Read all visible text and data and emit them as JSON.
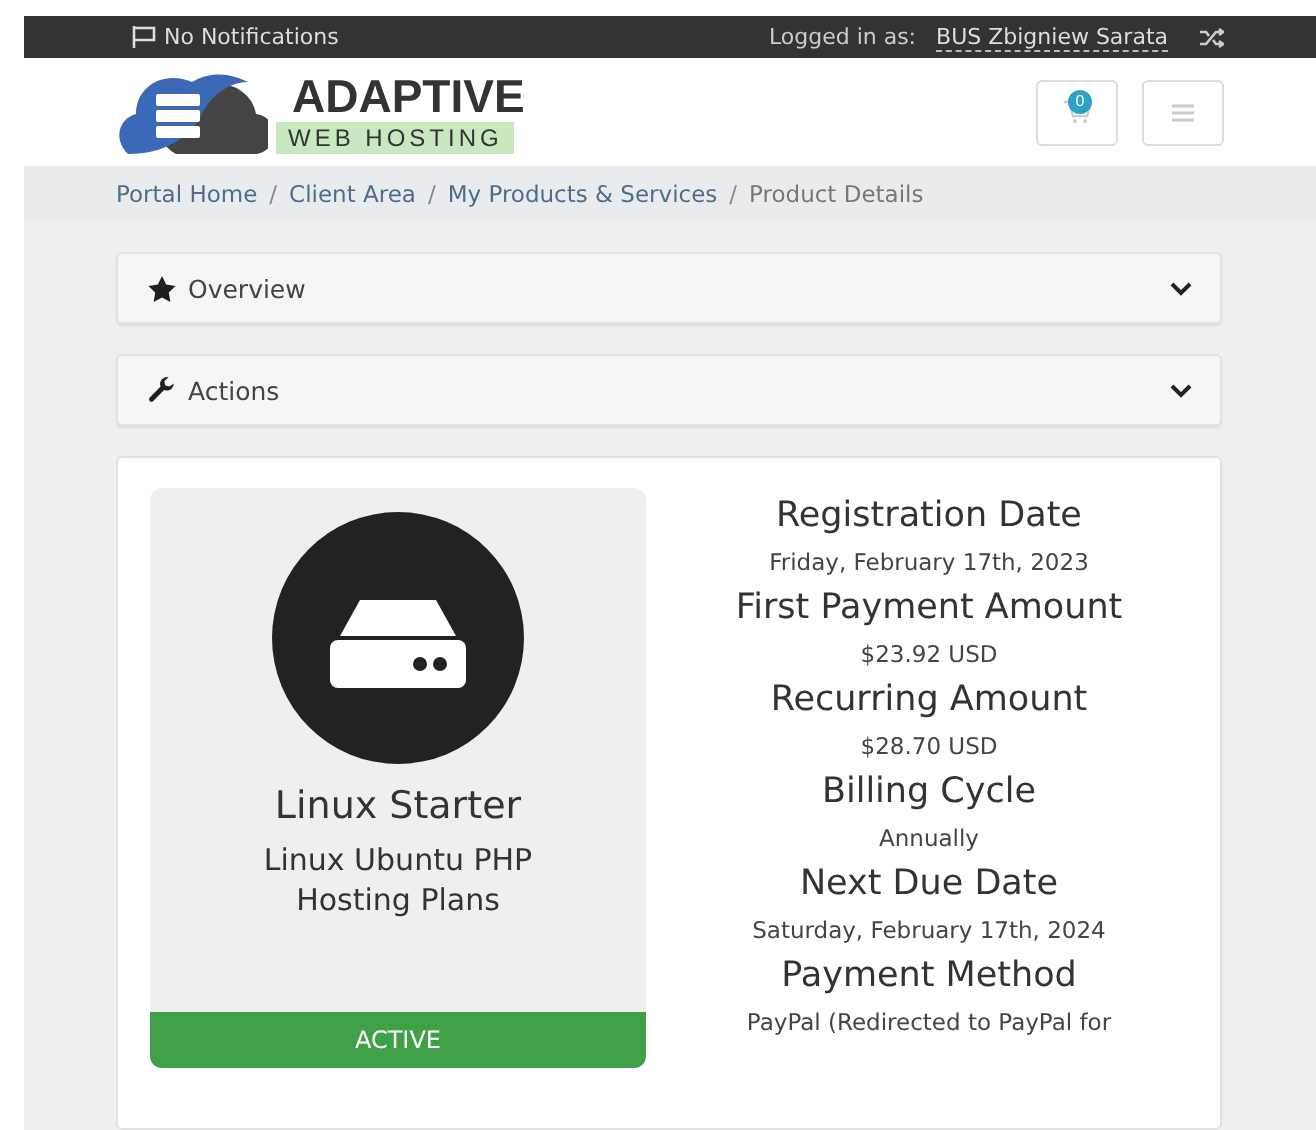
{
  "top_bar": {
    "notifications": "No Notifications",
    "logged_in_label": "Logged in as:",
    "user": "BUS Zbigniew Sarata"
  },
  "header": {
    "logo": {
      "title": "ADAPTIVE",
      "subtitle": "WEB HOSTING"
    },
    "cart_count": "0"
  },
  "breadcrumb": [
    {
      "label": "Portal Home",
      "link": true
    },
    {
      "separator": "/",
      "label": "Client Area",
      "link": true
    },
    {
      "separator": "/",
      "label": "My Products & Services",
      "link": true
    },
    {
      "separator": "/",
      "label": "Product Details",
      "link": false
    }
  ],
  "panels": [
    {
      "title": "Overview",
      "kind": "star",
      "expanded": false
    },
    {
      "title": "Actions",
      "kind": "wrench",
      "expanded": false
    }
  ],
  "product": {
    "name": "Linux Starter",
    "group": "Linux Ubuntu PHP Hosting Plans",
    "status": {
      "label": "ACTIVE",
      "kind": "active"
    }
  },
  "details": [
    {
      "label": "Registration Date",
      "value": "Friday, February 17th, 2023"
    },
    {
      "label": "First Payment Amount",
      "value": "$23.92 USD"
    },
    {
      "label": "Recurring Amount",
      "value": "$28.70 USD"
    },
    {
      "label": "Billing Cycle",
      "value": "Annually"
    },
    {
      "label": "Next Due Date",
      "value": "Saturday, February 17th, 2024"
    },
    {
      "label": "Payment Method",
      "value": "PayPal (Redirected to PayPal for"
    }
  ]
}
